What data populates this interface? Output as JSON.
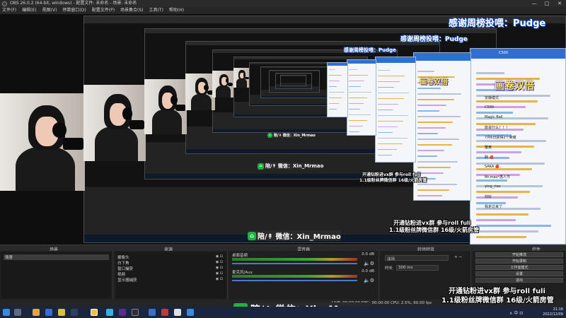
{
  "window": {
    "title": "OBS 26.0.2 (64-bit, windows) - 配置文件: 未命名 - 场景: 未命名",
    "controls": [
      "—",
      "□",
      "✕"
    ]
  },
  "menu": [
    "文件(F)",
    "编辑(E)",
    "视图(V)",
    "停靠窗口(D)",
    "配置文件(P)",
    "场景集合(S)",
    "工具(T)",
    "帮助(H)"
  ],
  "overlays": {
    "banner_main": "感谢周榜投喂：Pudge",
    "banner_mid": "感谢周榜投喂：Pudge",
    "banner_small": "感谢周榜投喂：Pudge",
    "double_roll": "画卷双倍",
    "double_roll_small": "画卷双倍",
    "promo_line1": "开通钻粉进vx群 参与roll fuli",
    "promo_line2": "1.1级粉丝牌微信群 16级/火箭房管",
    "wechat": "陪/↟ 微信：Xin_Mrmao",
    "wechat_icon": "⌂"
  },
  "chat": {
    "room_id": "C500",
    "lines": [
      "安静模式",
      "C500",
      "Magic Bell",
      "能说什么！！！",
      "7月6日获得2个荣耀",
      "蟹黄",
      "胖 🍎",
      "SAKA 🍎",
      "Mr.mao*愚人节",
      "ying_rise",
      "你好",
      "我走过来了"
    ]
  },
  "docks": {
    "headers": [
      "场景",
      "来源",
      "混音器",
      "转场特效",
      "控件"
    ],
    "scenes": {
      "items": [
        "场景"
      ]
    },
    "sources": {
      "items": [
        "摄像头",
        "白下角",
        "窗口捕获",
        "视频",
        "显示器捕获"
      ]
    },
    "mixer": {
      "tracks": [
        {
          "name": "桌面音频",
          "level": "0.0 dB"
        },
        {
          "name": "麦克风/Aux",
          "level": "0.0 dB"
        }
      ]
    },
    "transitions": {
      "type": "淡出",
      "duration_label": "时长",
      "duration": "300 ms"
    },
    "controls": {
      "buttons": [
        "开始推流",
        "开始录制",
        "工作室模式",
        "设置",
        "退出"
      ]
    }
  },
  "status": {
    "text": "LIVE: 00:00:00  REC: 00:00:00  CPU: 2.5%, 60.00 fps"
  },
  "taskbar": {
    "time": "21:16",
    "date": "2022/12/09",
    "tray": "∧ 中 ⊡"
  },
  "colors": {
    "accent_blue": "#2e6fd1",
    "banner_text": "#ffffff",
    "double_text": "#ffea58",
    "wechat_green": "#1fb141"
  }
}
